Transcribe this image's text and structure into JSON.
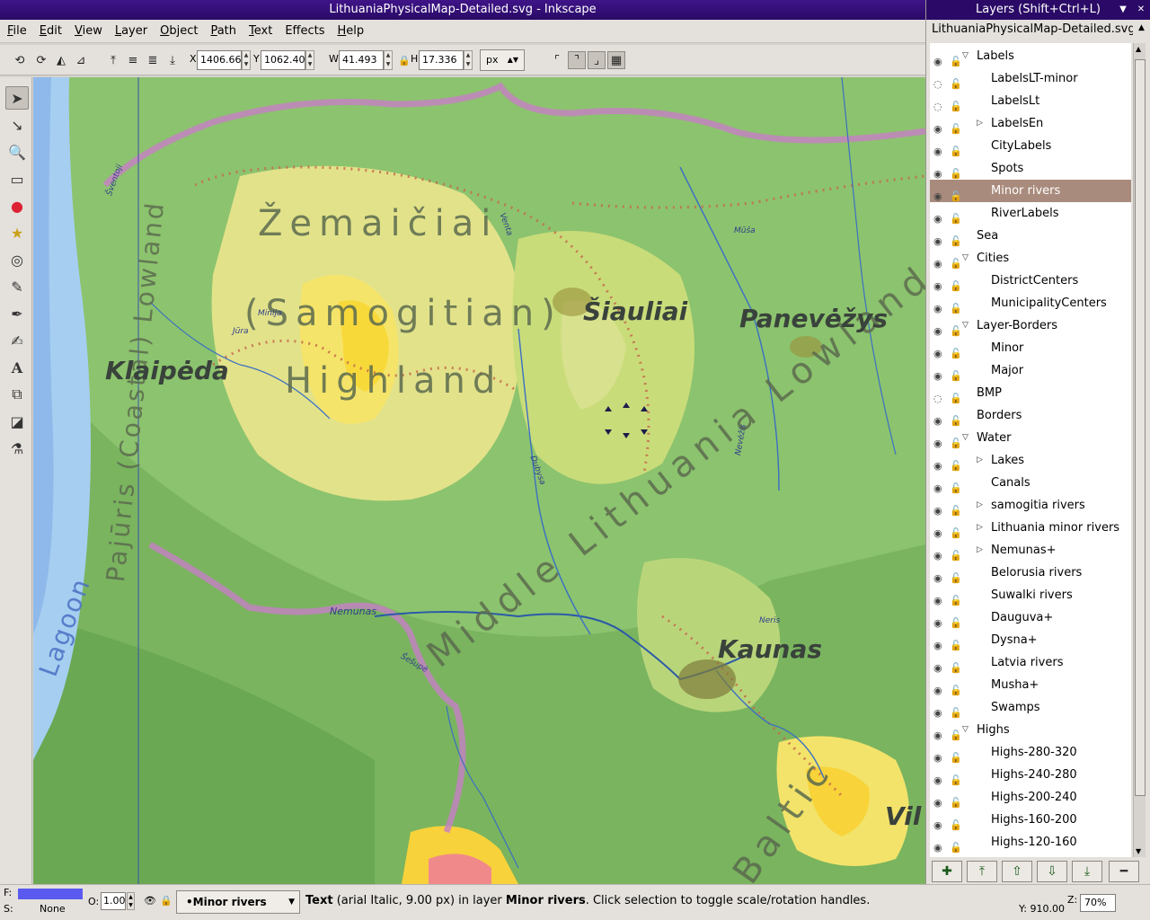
{
  "window": {
    "title": "LithuaniaPhysicalMap-Detailed.svg - Inkscape"
  },
  "menu": [
    {
      "label": "File",
      "u": "F",
      "rest": "ile"
    },
    {
      "label": "Edit",
      "u": "E",
      "rest": "dit"
    },
    {
      "label": "View",
      "u": "V",
      "rest": "iew"
    },
    {
      "label": "Layer",
      "u": "L",
      "rest": "ayer"
    },
    {
      "label": "Object",
      "u": "O",
      "rest": "bject"
    },
    {
      "label": "Path",
      "u": "P",
      "rest": "ath"
    },
    {
      "label": "Text",
      "u": "T",
      "rest": "ext"
    },
    {
      "label": "Effects",
      "u": "",
      "rest": "Effects"
    },
    {
      "label": "Help",
      "u": "H",
      "rest": "elp"
    }
  ],
  "controls": {
    "x_label": "X",
    "x_value": "1406.661",
    "y_label": "Y",
    "y_value": "1062.407",
    "w_label": "W",
    "w_value": "41.493",
    "h_label": "H",
    "h_value": "17.336",
    "units": "px"
  },
  "map_labels": {
    "zemaiciai": "Žemaičiai",
    "samogitian": "(Samogitian)",
    "highland": "Highland",
    "middle": "Middle Lithuania Lowland",
    "coastal": "Pajūris (Coastal) Lowland",
    "lagoon": "Lagoon",
    "baltic": "Baltic",
    "klaipeda": "Klaipėda",
    "siauliai": "Šiauliai",
    "panevezys": "Panevėžys",
    "kaunas": "Kaunas",
    "vil": "Vil",
    "nemunas": "Nemunas",
    "minija": "Minija",
    "jura": "Jūra",
    "dubysa": "Dubysa",
    "venta": "Venta",
    "neris": "Neris",
    "nevezis": "Nevėžis",
    "musa": "Mūša",
    "sesupe": "Šešupė",
    "sventoji": "Šventoji"
  },
  "layers_panel": {
    "title": "Layers (Shift+Ctrl+L)",
    "document": "LithuaniaPhysicalMap-Detailed.svg",
    "rows": [
      {
        "name": "Labels",
        "level": 0,
        "expand": "open",
        "selected": false,
        "eye": "open"
      },
      {
        "name": "LabelsLT-minor",
        "level": 1,
        "expand": "",
        "selected": false,
        "eye": "closed"
      },
      {
        "name": "LabelsLt",
        "level": 1,
        "expand": "",
        "selected": false,
        "eye": "closed"
      },
      {
        "name": "LabelsEn",
        "level": 1,
        "expand": "closed",
        "selected": false,
        "eye": "open"
      },
      {
        "name": "CityLabels",
        "level": 1,
        "expand": "",
        "selected": false,
        "eye": "open"
      },
      {
        "name": "Spots",
        "level": 1,
        "expand": "",
        "selected": false,
        "eye": "open"
      },
      {
        "name": "Minor rivers",
        "level": 1,
        "expand": "",
        "selected": true,
        "eye": "open"
      },
      {
        "name": "RiverLabels",
        "level": 1,
        "expand": "",
        "selected": false,
        "eye": "open"
      },
      {
        "name": "Sea",
        "level": 0,
        "expand": "",
        "selected": false,
        "eye": "open"
      },
      {
        "name": "Cities",
        "level": 0,
        "expand": "open",
        "selected": false,
        "eye": "open"
      },
      {
        "name": "DistrictCenters",
        "level": 1,
        "expand": "",
        "selected": false,
        "eye": "open"
      },
      {
        "name": "MunicipalityCenters",
        "level": 1,
        "expand": "",
        "selected": false,
        "eye": "open"
      },
      {
        "name": "Layer-Borders",
        "level": 0,
        "expand": "open",
        "selected": false,
        "eye": "open"
      },
      {
        "name": "Minor",
        "level": 1,
        "expand": "",
        "selected": false,
        "eye": "open"
      },
      {
        "name": "Major",
        "level": 1,
        "expand": "",
        "selected": false,
        "eye": "open"
      },
      {
        "name": "BMP",
        "level": 0,
        "expand": "",
        "selected": false,
        "eye": "closed"
      },
      {
        "name": "Borders",
        "level": 0,
        "expand": "",
        "selected": false,
        "eye": "open"
      },
      {
        "name": "Water",
        "level": 0,
        "expand": "open",
        "selected": false,
        "eye": "open"
      },
      {
        "name": "Lakes",
        "level": 1,
        "expand": "closed",
        "selected": false,
        "eye": "open"
      },
      {
        "name": "Canals",
        "level": 1,
        "expand": "",
        "selected": false,
        "eye": "open"
      },
      {
        "name": "samogitia rivers",
        "level": 1,
        "expand": "closed",
        "selected": false,
        "eye": "open"
      },
      {
        "name": "Lithuania minor rivers",
        "level": 1,
        "expand": "closed",
        "selected": false,
        "eye": "open"
      },
      {
        "name": "Nemunas+",
        "level": 1,
        "expand": "closed",
        "selected": false,
        "eye": "open"
      },
      {
        "name": "Belorusia rivers",
        "level": 1,
        "expand": "",
        "selected": false,
        "eye": "open"
      },
      {
        "name": "Suwalki rivers",
        "level": 1,
        "expand": "",
        "selected": false,
        "eye": "open"
      },
      {
        "name": "Dauguva+",
        "level": 1,
        "expand": "",
        "selected": false,
        "eye": "open"
      },
      {
        "name": "Dysna+",
        "level": 1,
        "expand": "",
        "selected": false,
        "eye": "open"
      },
      {
        "name": "Latvia rivers",
        "level": 1,
        "expand": "",
        "selected": false,
        "eye": "open"
      },
      {
        "name": "Musha+",
        "level": 1,
        "expand": "",
        "selected": false,
        "eye": "open"
      },
      {
        "name": "Swamps",
        "level": 1,
        "expand": "",
        "selected": false,
        "eye": "open"
      },
      {
        "name": "Highs",
        "level": 0,
        "expand": "open",
        "selected": false,
        "eye": "open"
      },
      {
        "name": "Highs-280-320",
        "level": 1,
        "expand": "",
        "selected": false,
        "eye": "open"
      },
      {
        "name": "Highs-240-280",
        "level": 1,
        "expand": "",
        "selected": false,
        "eye": "open"
      },
      {
        "name": "Highs-200-240",
        "level": 1,
        "expand": "",
        "selected": false,
        "eye": "open"
      },
      {
        "name": "Highs-160-200",
        "level": 1,
        "expand": "",
        "selected": false,
        "eye": "open"
      },
      {
        "name": "Highs-120-160",
        "level": 1,
        "expand": "",
        "selected": false,
        "eye": "open"
      }
    ]
  },
  "status": {
    "fill_label": "F:",
    "stroke_label": "S:",
    "stroke_value": "None",
    "opacity_label": "O:",
    "opacity_value": "1.00",
    "current_layer": "•Minor rivers",
    "msg_type": "Text",
    "msg_font": " (arial Italic, 9.00 px) in layer ",
    "msg_layer": "Minor rivers",
    "msg_rest": ". Click selection to toggle scale/rotation handles.",
    "cursor_y": "Y: 910.00",
    "zoom_label": "Z:",
    "zoom_value": "70%"
  },
  "colors": {
    "selected_row": "#a98b7d",
    "titlebar": "#2a0a66",
    "fill_swatch": "#5a5af0"
  }
}
